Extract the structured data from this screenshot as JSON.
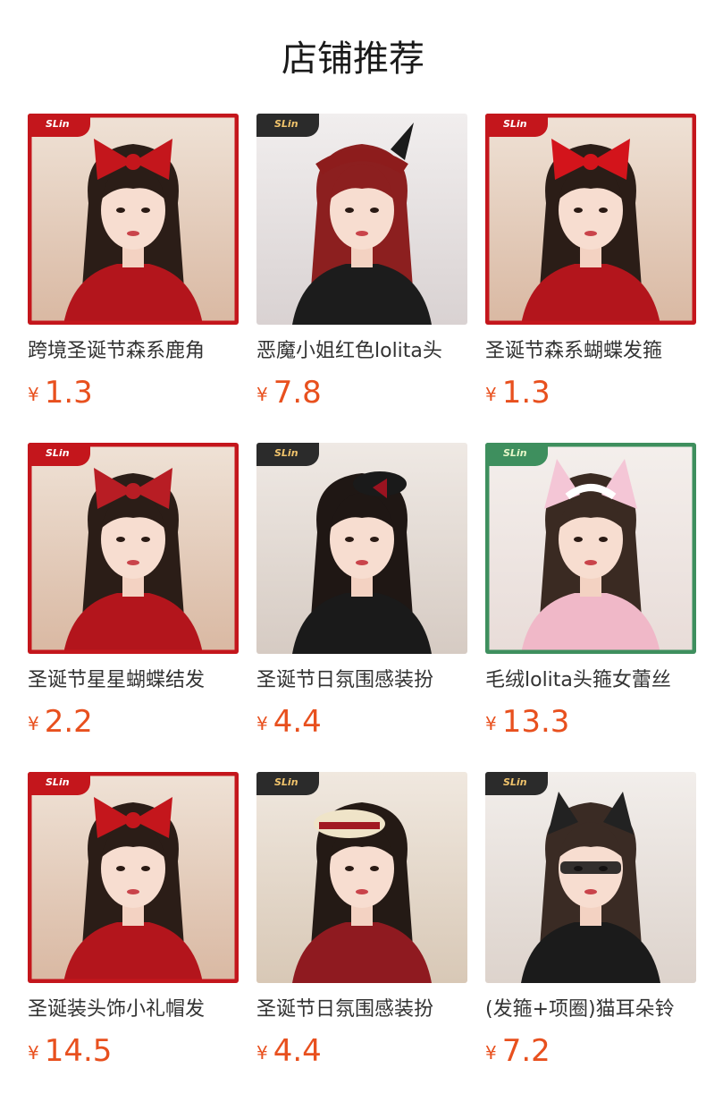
{
  "page": {
    "title": "店铺推荐"
  },
  "brand": "SLin",
  "currency": "¥",
  "products": [
    {
      "name": "跨境圣诞节森系鹿角",
      "price": "1.3",
      "theme": "christmas-red",
      "accent": "#c4161c"
    },
    {
      "name": "恶魔小姐红色lolita头",
      "price": "7.8",
      "theme": "gothic-red",
      "accent": "#8d1c1c"
    },
    {
      "name": "圣诞节森系蝴蝶发箍",
      "price": "1.3",
      "theme": "christmas-red",
      "accent": "#d3141b"
    },
    {
      "name": "圣诞节星星蝴蝶结发",
      "price": "2.2",
      "theme": "christmas-red",
      "accent": "#b81d24"
    },
    {
      "name": "圣诞节日氛围感装扮",
      "price": "4.4",
      "theme": "dark-bow",
      "accent": "#9a1320"
    },
    {
      "name": "毛绒lolita头箍女蕾丝",
      "price": "13.3",
      "theme": "green-pink",
      "accent": "#f2a7c1"
    },
    {
      "name": "圣诞装头饰小礼帽发",
      "price": "14.5",
      "theme": "christmas-red",
      "accent": "#c4161c"
    },
    {
      "name": "圣诞节日氛围感装扮",
      "price": "4.4",
      "theme": "beret",
      "accent": "#a21a22"
    },
    {
      "name": "(发箍+项圈)猫耳朵铃",
      "price": "7.2",
      "theme": "cat-ears",
      "accent": "#222222"
    }
  ]
}
